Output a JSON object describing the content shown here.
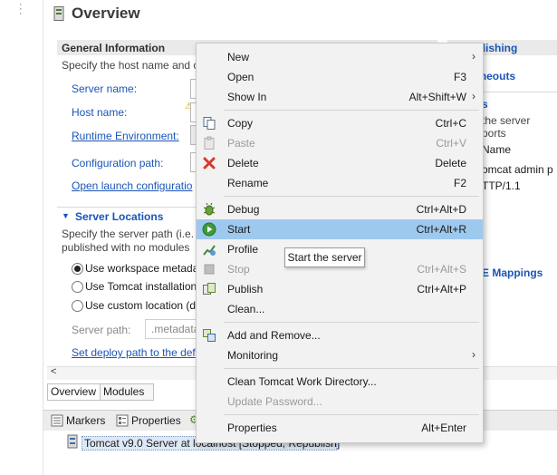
{
  "editor": {
    "title": "Overview",
    "general": {
      "heading": "General Information",
      "desc": "Specify the host name and c",
      "server_name_label": "Server name:",
      "host_name_label": "Host name:",
      "runtime_env_link": "Runtime Environment:",
      "config_path_label": "Configuration path:",
      "open_launch_link": "Open launch configuratio"
    },
    "locations": {
      "heading": "Server Locations",
      "desc1": "Specify the server path (i.e. c",
      "desc2": "published with no modules",
      "opt_workspace": "Use workspace metada",
      "opt_tomcat": "Use Tomcat installation",
      "opt_custom": "Use custom location (d",
      "server_path_label": "Server path:",
      "server_path_value": ".metadata",
      "deploy_link": "Set deploy path to the def"
    },
    "right": {
      "publishing": "Publishing",
      "timeouts": "Timeouts",
      "ports": "s",
      "ports_desc": "the server ports",
      "name_col": "Name",
      "row1": "omcat admin p",
      "row2": "TTP/1.1",
      "mime": "E Mappings"
    },
    "bottom_tabs": [
      "Overview",
      "Modules"
    ]
  },
  "views": {
    "tabs": [
      "Markers",
      "Properties"
    ],
    "server_row": "Tomcat v9.0 Server at localhost  [Stopped, Republish]"
  },
  "menu": {
    "items": [
      {
        "label": "New",
        "accel": "",
        "submenu": true,
        "icon": ""
      },
      {
        "label": "Open",
        "accel": "F3",
        "submenu": false,
        "icon": ""
      },
      {
        "label": "Show In",
        "accel": "Alt+Shift+W",
        "submenu": true,
        "icon": ""
      },
      {
        "label": "Copy",
        "accel": "Ctrl+C",
        "submenu": false,
        "icon": "copy-icon"
      },
      {
        "label": "Paste",
        "accel": "Ctrl+V",
        "submenu": false,
        "icon": "paste-icon",
        "disabled": true
      },
      {
        "label": "Delete",
        "accel": "Delete",
        "submenu": false,
        "icon": "delete-icon"
      },
      {
        "label": "Rename",
        "accel": "F2",
        "submenu": false,
        "icon": ""
      },
      {
        "label": "Debug",
        "accel": "Ctrl+Alt+D",
        "submenu": false,
        "icon": "debug-icon"
      },
      {
        "label": "Start",
        "accel": "Ctrl+Alt+R",
        "submenu": false,
        "icon": "start-icon",
        "selected": true
      },
      {
        "label": "Profile",
        "accel": "",
        "submenu": false,
        "icon": "profile-icon"
      },
      {
        "label": "Stop",
        "accel": "Ctrl+Alt+S",
        "submenu": false,
        "icon": "stop-icon",
        "disabled": true
      },
      {
        "label": "Publish",
        "accel": "Ctrl+Alt+P",
        "submenu": false,
        "icon": "publish-icon"
      },
      {
        "label": "Clean...",
        "accel": "",
        "submenu": false,
        "icon": ""
      },
      {
        "label": "Add and Remove...",
        "accel": "",
        "submenu": false,
        "icon": "add-remove-icon"
      },
      {
        "label": "Monitoring",
        "accel": "",
        "submenu": true,
        "icon": ""
      },
      {
        "label": "Clean Tomcat Work Directory...",
        "accel": "",
        "submenu": false,
        "icon": ""
      },
      {
        "label": "Update Password...",
        "accel": "",
        "submenu": false,
        "icon": "",
        "disabled": true
      },
      {
        "label": "Properties",
        "accel": "Alt+Enter",
        "submenu": false,
        "icon": ""
      }
    ],
    "tooltip": "Start the server"
  },
  "colors": {
    "link": "#1a55b6",
    "selection": "#9ec9ee",
    "menu_bg": "#f2f2f2"
  }
}
